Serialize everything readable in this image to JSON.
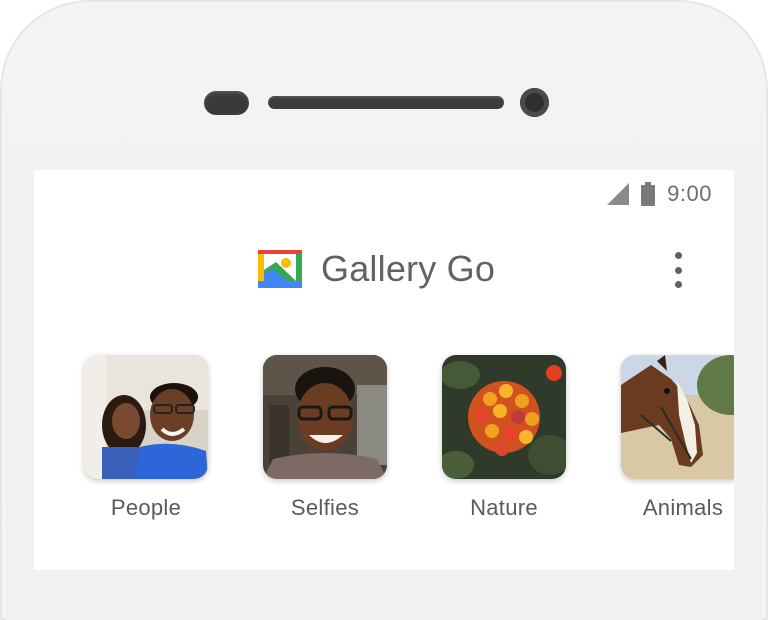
{
  "status_bar": {
    "time": "9:00",
    "signal_icon": "signal-icon",
    "battery_icon": "battery-icon"
  },
  "header": {
    "app_title": "Gallery Go",
    "logo_icon": "gallery-go-logo",
    "menu_icon": "more-vertical-icon"
  },
  "categories": [
    {
      "label": "People",
      "thumbnail": "two people smiling in blue shirts"
    },
    {
      "label": "Selfies",
      "thumbnail": "smiling man with glasses"
    },
    {
      "label": "Nature",
      "thumbnail": "orange and red flower cluster"
    },
    {
      "label": "Animals",
      "thumbnail": "brown horse with white blaze"
    }
  ],
  "colors": {
    "logo_red": "#ea4335",
    "logo_yellow": "#fbbc04",
    "logo_green": "#34a853",
    "logo_blue": "#4285f4",
    "title_gray": "#5f6368"
  }
}
